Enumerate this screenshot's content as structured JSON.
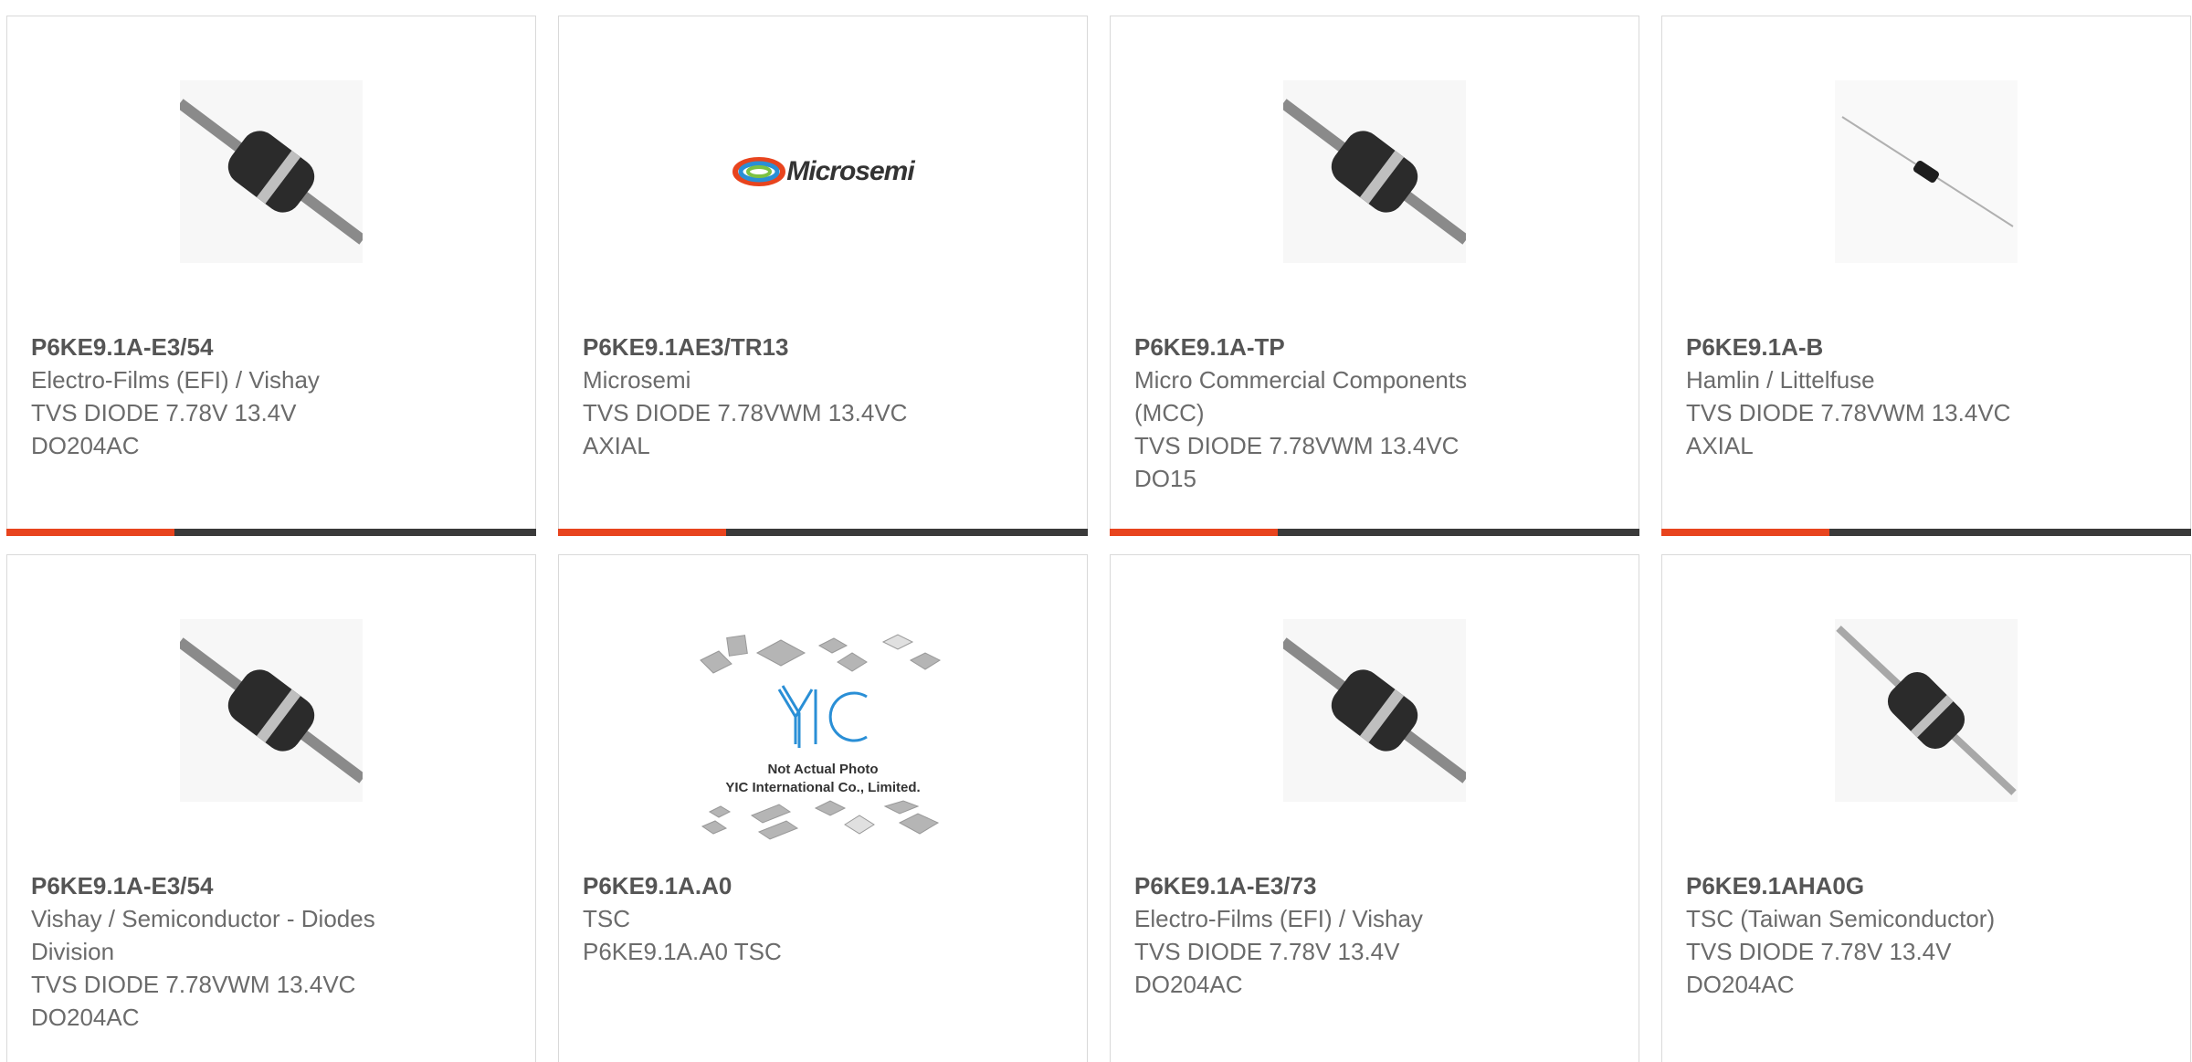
{
  "colors": {
    "accent": "#e8441e",
    "bar": "#3a3a3a",
    "text": "#6b6b6b",
    "border": "#d9d9d9"
  },
  "cards": [
    {
      "image": "axial-diode-large",
      "part": "P6KE9.1A-E3/54",
      "lines": [
        "Electro-Films (EFI) / Vishay",
        "TVS DIODE 7.78V 13.4V",
        "DO204AC"
      ]
    },
    {
      "image": "microsemi-logo",
      "logo_text": "Microsemi",
      "part": "P6KE9.1AE3/TR13",
      "lines": [
        "Microsemi",
        "TVS DIODE 7.78VWM 13.4VC",
        "AXIAL"
      ]
    },
    {
      "image": "axial-diode-large",
      "part": "P6KE9.1A-TP",
      "lines": [
        "Micro Commercial Components",
        "(MCC)",
        "TVS DIODE 7.78VWM 13.4VC",
        "DO15"
      ]
    },
    {
      "image": "axial-diode-small",
      "part": "P6KE9.1A-B",
      "lines": [
        "Hamlin / Littelfuse",
        "TVS DIODE 7.78VWM 13.4VC",
        "AXIAL"
      ]
    },
    {
      "image": "axial-diode-large",
      "part": "P6KE9.1A-E3/54",
      "lines": [
        "Vishay / Semiconductor - Diodes",
        "Division",
        "TVS DIODE 7.78VWM 13.4VC",
        "DO204AC"
      ]
    },
    {
      "image": "yic-placeholder",
      "placeholder_lines": [
        "Not Actual Photo",
        "YIC International Co., Limited."
      ],
      "part": "P6KE9.1A.A0",
      "lines": [
        "TSC",
        "P6KE9.1A.A0 TSC"
      ]
    },
    {
      "image": "axial-diode-large",
      "part": "P6KE9.1A-E3/73",
      "lines": [
        "Electro-Films (EFI) / Vishay",
        "TVS DIODE 7.78V 13.4V",
        "DO204AC"
      ]
    },
    {
      "image": "axial-diode-angled",
      "part": "P6KE9.1AHA0G",
      "lines": [
        "TSC (Taiwan Semiconductor)",
        "TVS DIODE 7.78V 13.4V",
        "DO204AC"
      ]
    }
  ]
}
